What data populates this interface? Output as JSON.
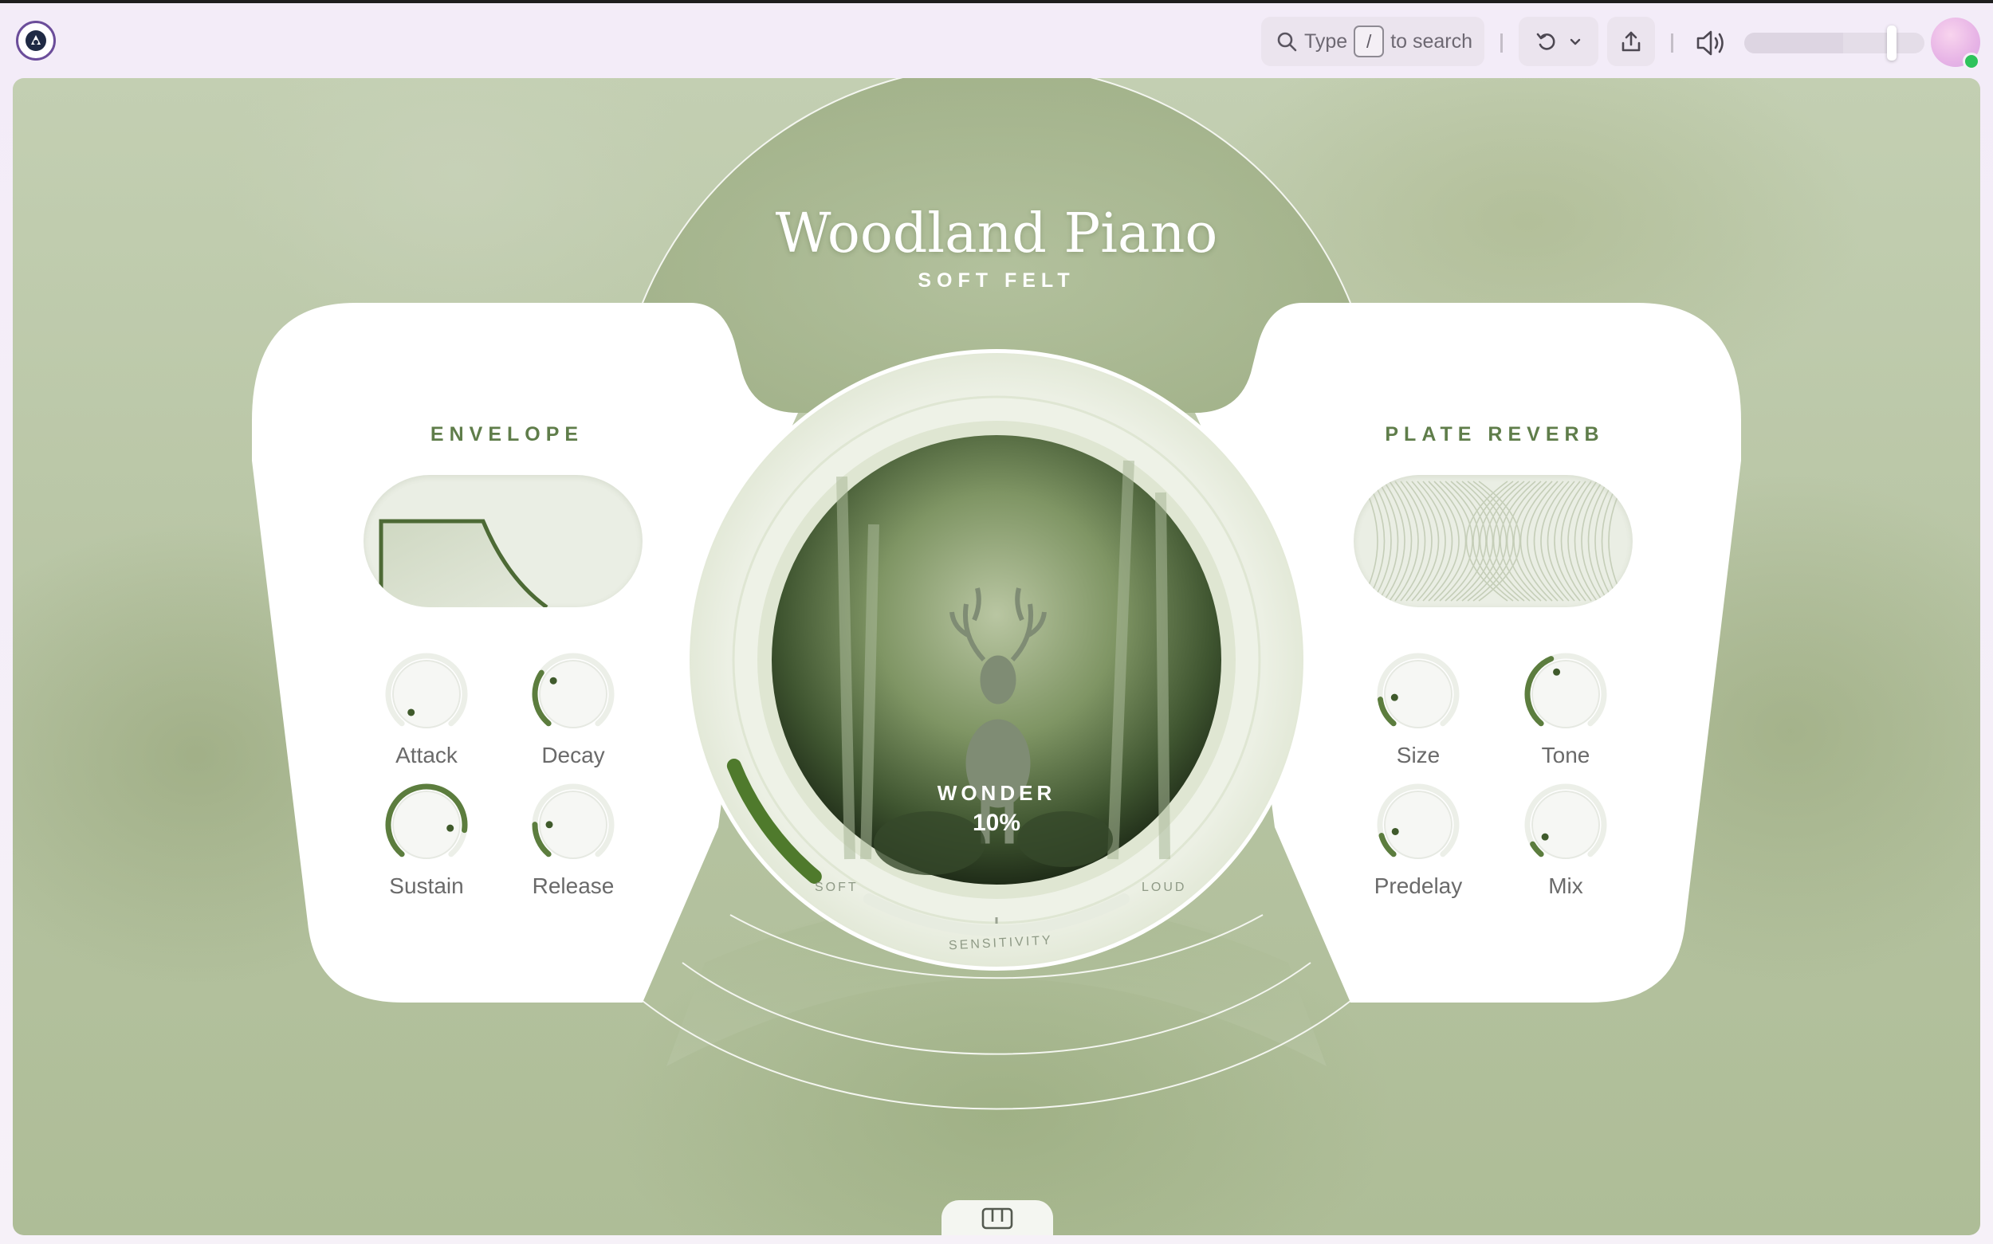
{
  "toolbar": {
    "search_prefix": "Type",
    "search_key": "/",
    "search_suffix": "to search",
    "volume_level": 0.55
  },
  "icons": {
    "logo": "app-logo-icon",
    "search": "search-icon",
    "undo": "undo-icon",
    "chevron": "chevron-down-icon",
    "share": "share-icon",
    "volume": "volume-icon",
    "keyboard": "keyboard-icon"
  },
  "colors": {
    "accent": "#5c7d3e",
    "status_online": "#2fc35b"
  },
  "instrument": {
    "title": "Woodland Piano",
    "subtitle": "SOFT FELT",
    "macro_label": "WONDER",
    "macro_value_text": "10%",
    "macro_value": 0.1,
    "sensitivity_label": "SENSITIVITY",
    "soft_label": "SOFT",
    "loud_label": "LOUD",
    "sensitivity_value": 0.5
  },
  "envelope": {
    "title": "ENVELOPE",
    "knobs": [
      {
        "label": "Attack",
        "value": 0.0
      },
      {
        "label": "Decay",
        "value": 0.3
      },
      {
        "label": "Sustain",
        "value": 0.85
      },
      {
        "label": "Release",
        "value": 0.18
      }
    ]
  },
  "reverb": {
    "title": "PLATE REVERB",
    "knobs": [
      {
        "label": "Size",
        "value": 0.15
      },
      {
        "label": "Tone",
        "value": 0.42
      },
      {
        "label": "Predelay",
        "value": 0.12
      },
      {
        "label": "Mix",
        "value": 0.07
      }
    ]
  }
}
